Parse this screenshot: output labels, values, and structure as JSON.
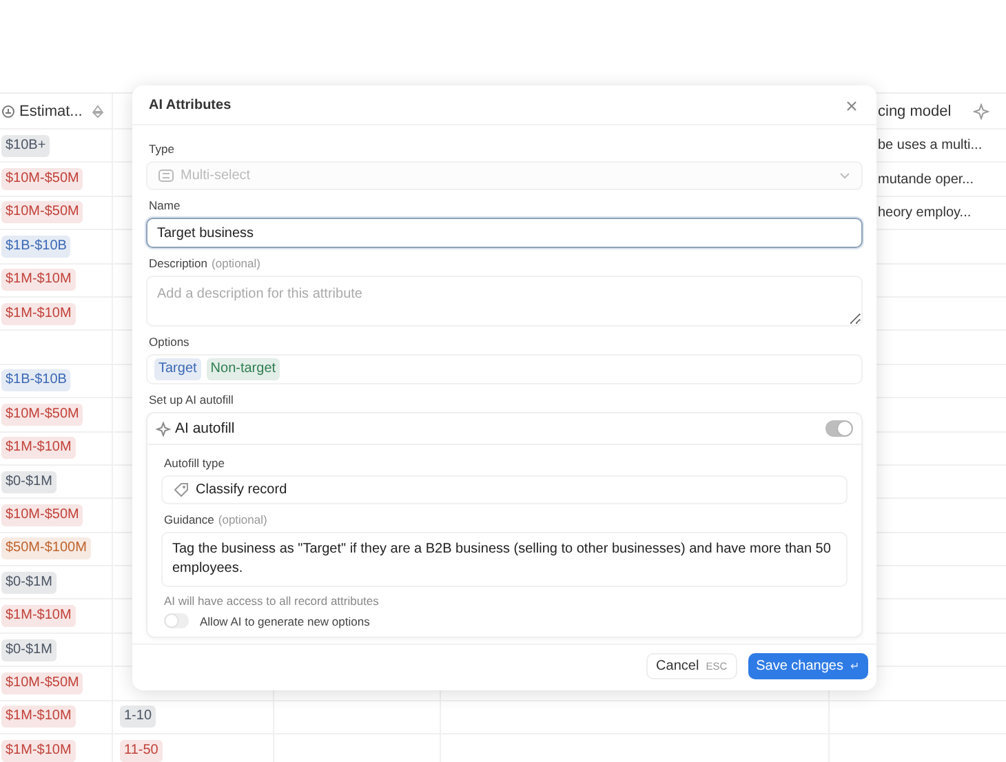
{
  "table": {
    "header": {
      "column_1": "Estimat...",
      "column_5": "cing model"
    },
    "rows": [
      {
        "column_1": {
          "text": "$10B+",
          "color": "#4b5563"
        },
        "column_5": "be uses a multi..."
      },
      {
        "column_1": {
          "text": "$10M-$50M",
          "color": "#c2413a"
        },
        "column_5": "mutande oper..."
      },
      {
        "column_1": {
          "text": "$10M-$50M",
          "color": "#c2413a"
        },
        "column_5": "heory employ..."
      },
      {
        "column_1": {
          "text": "$1B-$10B",
          "color": "#3b68b5"
        }
      },
      {
        "column_1": {
          "text": "$1M-$10M",
          "color": "#c2413a"
        }
      },
      {
        "column_1": {
          "text": "$1M-$10M",
          "color": "#c2413a"
        }
      },
      {},
      {
        "column_1": {
          "text": "$1B-$10B",
          "color": "#3b68b5"
        }
      },
      {
        "column_1": {
          "text": "$10M-$50M",
          "color": "#c2413a"
        }
      },
      {
        "column_1": {
          "text": "$1M-$10M",
          "color": "#c2413a"
        }
      },
      {
        "column_1": {
          "text": "$0-$1M",
          "color": "#4b5563"
        }
      },
      {
        "column_1": {
          "text": "$10M-$50M",
          "color": "#c2413a"
        }
      },
      {
        "column_1": {
          "text": "$50M-$100M",
          "color": "#c0622b"
        }
      },
      {
        "column_1": {
          "text": "$0-$1M",
          "color": "#4b5563"
        }
      },
      {
        "column_1": {
          "text": "$1M-$10M",
          "color": "#c2413a"
        }
      },
      {
        "column_1": {
          "text": "$0-$1M",
          "color": "#4b5563"
        }
      },
      {
        "column_1": {
          "text": "$10M-$50M",
          "color": "#c2413a"
        }
      },
      {
        "column_1": {
          "text": "$1M-$10M",
          "color": "#c2413a"
        },
        "column_2": {
          "text": "1-10",
          "color": "#4b5563"
        }
      },
      {
        "column_1": {
          "text": "$1M-$10M",
          "color": "#c2413a"
        },
        "column_2": {
          "text": "11-50",
          "color": "#c2413a"
        }
      }
    ]
  },
  "dialog": {
    "title": "AI Attributes",
    "type": {
      "label": "Type",
      "value": "Multi-select",
      "disabled": true
    },
    "name": {
      "label": "Name",
      "value": "Target business"
    },
    "description": {
      "label": "Description",
      "hint": "(optional)",
      "placeholder": "Add a description for this attribute"
    },
    "options": {
      "label": "Options",
      "items": [
        {
          "text": "Target",
          "color": "#3b68b5"
        },
        {
          "text": "Non-target",
          "color": "#2f7d4f"
        }
      ]
    },
    "autofill": {
      "label": "Set up AI autofill",
      "title": "AI autofill",
      "on": true,
      "type_label": "Autofill type",
      "type_value": "Classify record",
      "guidance_label": "Guidance",
      "guidance_hint": "(optional)",
      "guidance": "Tag the business as \"Target\" if they are a B2B business (selling to other businesses) and have more than 50 employees.",
      "note": "AI will have access to all record attributes",
      "allow_new": {
        "label": "Allow AI to generate new options",
        "on": false
      }
    },
    "cancel": "Cancel",
    "cancel_key": "ESC",
    "save": "Save changes",
    "save_key": "↵"
  }
}
